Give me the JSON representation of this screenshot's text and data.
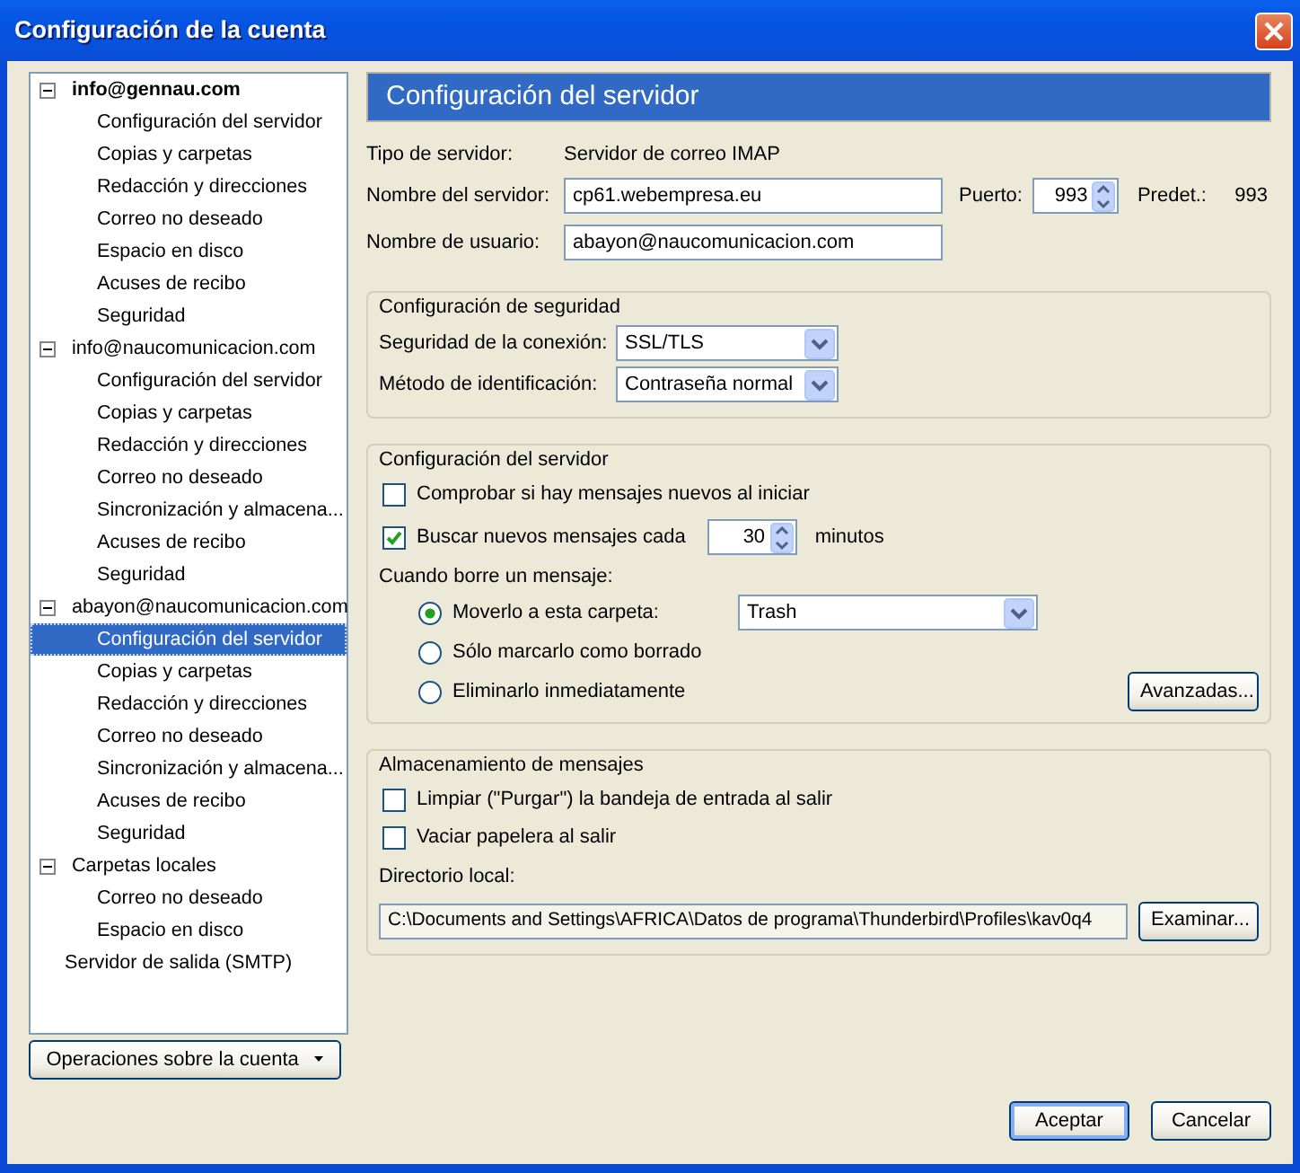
{
  "window": {
    "title": "Configuración de la cuenta"
  },
  "tree": [
    {
      "label": "info@gennau.com",
      "default": true,
      "expanded": true,
      "selected": false,
      "children": [
        {
          "label": "Configuración del servidor",
          "selected": false
        },
        {
          "label": "Copias y carpetas",
          "selected": false
        },
        {
          "label": "Redacción y direcciones",
          "selected": false
        },
        {
          "label": "Correo no deseado",
          "selected": false
        },
        {
          "label": "Espacio en disco",
          "selected": false
        },
        {
          "label": "Acuses de recibo",
          "selected": false
        },
        {
          "label": "Seguridad",
          "selected": false
        }
      ]
    },
    {
      "label": "info@naucomunicacion.com",
      "default": false,
      "expanded": true,
      "selected": false,
      "children": [
        {
          "label": "Configuración del servidor",
          "selected": false
        },
        {
          "label": "Copias y carpetas",
          "selected": false
        },
        {
          "label": "Redacción y direcciones",
          "selected": false
        },
        {
          "label": "Correo no deseado",
          "selected": false
        },
        {
          "label": "Sincronización y almacena...",
          "selected": false
        },
        {
          "label": "Acuses de recibo",
          "selected": false
        },
        {
          "label": "Seguridad",
          "selected": false
        }
      ]
    },
    {
      "label": "abayon@naucomunicacion.com",
      "default": false,
      "expanded": true,
      "selected": false,
      "children": [
        {
          "label": "Configuración del servidor",
          "selected": true
        },
        {
          "label": "Copias y carpetas",
          "selected": false
        },
        {
          "label": "Redacción y direcciones",
          "selected": false
        },
        {
          "label": "Correo no deseado",
          "selected": false
        },
        {
          "label": "Sincronización y almacena...",
          "selected": false
        },
        {
          "label": "Acuses de recibo",
          "selected": false
        },
        {
          "label": "Seguridad",
          "selected": false
        }
      ]
    },
    {
      "label": "Carpetas locales",
      "default": false,
      "expanded": true,
      "selected": false,
      "children": [
        {
          "label": "Correo no deseado",
          "selected": false
        },
        {
          "label": "Espacio en disco",
          "selected": false
        }
      ]
    },
    {
      "label": "Servidor de salida (SMTP)",
      "default": false,
      "selected": false
    }
  ],
  "account_actions_button": "Operaciones sobre la cuenta",
  "panel": {
    "title": "Configuración del servidor",
    "server_type": {
      "label": "Tipo de servidor:",
      "value": "Servidor de correo IMAP"
    },
    "server_name": {
      "label": "Nombre del servidor:",
      "value": "cp61.webempresa.eu"
    },
    "port": {
      "label": "Puerto:",
      "value": "993"
    },
    "default_port": {
      "label": "Predet.:",
      "value": "993"
    },
    "username": {
      "label": "Nombre de usuario:",
      "value": "abayon@naucomunicacion.com"
    },
    "security": {
      "title": "Configuración de seguridad",
      "fields": [
        {
          "label": "Seguridad de la conexión:",
          "value": "SSL/TLS"
        },
        {
          "label": "Método de identificación:",
          "value": "Contraseña normal"
        }
      ]
    },
    "server_settings": {
      "title": "Configuración del servidor",
      "check_on_startup": {
        "label": "Comprobar si hay mensajes nuevos al iniciar",
        "checked": false
      },
      "check_every": {
        "label": "Buscar nuevos mensajes cada",
        "checked": true,
        "value": "30",
        "unit": "minutos"
      },
      "delete_label": "Cuando borre un mensaje:",
      "delete_options": [
        {
          "label": "Moverlo a esta carpeta:",
          "selected": true,
          "folder": "Trash"
        },
        {
          "label": "Sólo marcarlo como borrado",
          "selected": false
        },
        {
          "label": "Eliminarlo inmediatamente",
          "selected": false
        }
      ],
      "advanced_button": "Avanzadas..."
    },
    "storage": {
      "title": "Almacenamiento de mensajes",
      "options": [
        {
          "label": "Limpiar (\"Purgar\") la bandeja de entrada al salir",
          "checked": false
        },
        {
          "label": "Vaciar papelera al salir",
          "checked": false
        }
      ],
      "directory_label": "Directorio local:",
      "directory": "C:\\Documents and Settings\\AFRICA\\Datos de programa\\Thunderbird\\Profiles\\kav0q4",
      "browse_button": "Examinar..."
    }
  },
  "buttons": [
    {
      "label": "Aceptar",
      "default": true
    },
    {
      "label": "Cancelar",
      "default": false
    }
  ]
}
